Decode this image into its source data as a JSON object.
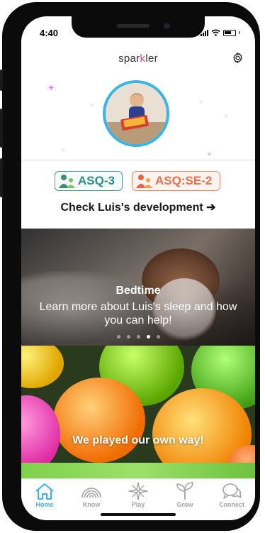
{
  "status_bar": {
    "time": "4:40"
  },
  "header": {
    "logo_left": "spar",
    "logo_k": "k",
    "logo_right": "ler"
  },
  "assessments": {
    "asq3": "ASQ-3",
    "asqse2": "ASQ:SE-2"
  },
  "check_development": "Check Luis's development ➔",
  "carousel": {
    "title": "Bedtime",
    "subtitle": "Learn more about Luis's sleep and how you can help!",
    "dot_count": 5,
    "active_dot": 3
  },
  "activity_card": {
    "caption": "We played our own way!"
  },
  "tabbar": {
    "tabs": [
      {
        "label": "Home",
        "icon": "home-icon",
        "active": true
      },
      {
        "label": "Know",
        "icon": "rainbow-icon",
        "active": false
      },
      {
        "label": "Play",
        "icon": "sparkle-icon",
        "active": false
      },
      {
        "label": "Grow",
        "icon": "sprout-icon",
        "active": false
      },
      {
        "label": "Connect",
        "icon": "chat-bubbles-icon",
        "active": false
      }
    ]
  },
  "colors": {
    "accent": "#37b5e8",
    "asq3": "#2b8f86",
    "asqse2": "#ea6f4a",
    "inactive_tab": "#a4a4a4"
  }
}
